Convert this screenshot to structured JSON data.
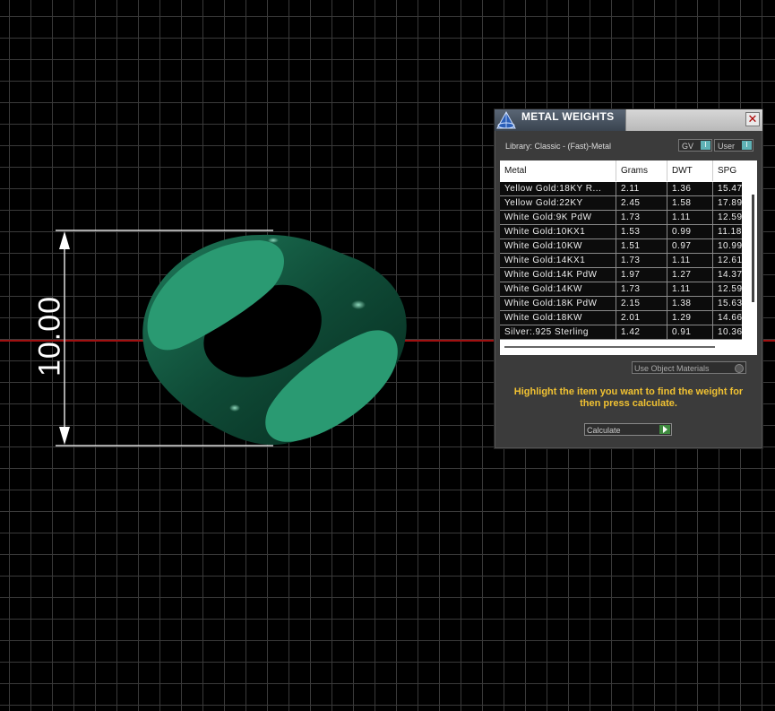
{
  "viewport": {
    "dimension_value": "10.00",
    "model_color": "#2a9a72",
    "axis_color": "#a01010"
  },
  "panel": {
    "title": "METAL WEIGHTS",
    "close_glyph": "✕",
    "library_label": "Library: Classic - (Fast)-Metal",
    "toggle_gv": "GV",
    "toggle_user": "User",
    "table": {
      "headers": {
        "metal": "Metal",
        "grams": "Grams",
        "dwt": "DWT",
        "spg": "SPG"
      },
      "rows": [
        {
          "metal": "Yellow Gold:18KY R...",
          "grams": "2.11",
          "dwt": "1.36",
          "spg": "15.47"
        },
        {
          "metal": "Yellow Gold:22KY",
          "grams": "2.45",
          "dwt": "1.58",
          "spg": "17.89"
        },
        {
          "metal": "White Gold:9K PdW",
          "grams": "1.73",
          "dwt": "1.11",
          "spg": "12.59"
        },
        {
          "metal": "White Gold:10KX1",
          "grams": "1.53",
          "dwt": "0.99",
          "spg": "11.18"
        },
        {
          "metal": "White Gold:10KW",
          "grams": "1.51",
          "dwt": "0.97",
          "spg": "10.99"
        },
        {
          "metal": "White Gold:14KX1",
          "grams": "1.73",
          "dwt": "1.11",
          "spg": "12.61"
        },
        {
          "metal": "White Gold:14K PdW",
          "grams": "1.97",
          "dwt": "1.27",
          "spg": "14.37"
        },
        {
          "metal": "White Gold:14KW",
          "grams": "1.73",
          "dwt": "1.11",
          "spg": "12.59"
        },
        {
          "metal": "White Gold:18K PdW",
          "grams": "2.15",
          "dwt": "1.38",
          "spg": "15.63"
        },
        {
          "metal": "White Gold:18KW",
          "grams": "2.01",
          "dwt": "1.29",
          "spg": "14.66"
        },
        {
          "metal": "Silver:.925 Sterling",
          "grams": "1.42",
          "dwt": "0.91",
          "spg": "10.36"
        }
      ]
    },
    "use_object_materials": "Use Object Materials",
    "instruction": "Highlight the item you want to find the weight for then press calculate.",
    "calculate_label": "Calculate",
    "accent_color": "#f1c232"
  }
}
